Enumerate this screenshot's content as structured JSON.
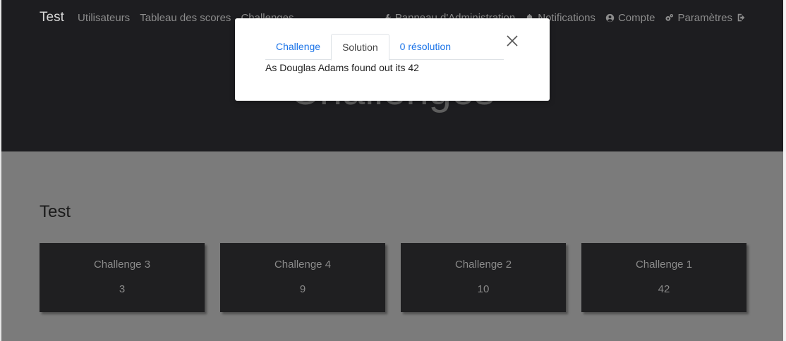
{
  "navbar": {
    "brand": "Test",
    "left_links": [
      "Utilisateurs",
      "Tableau des scores",
      "Challenges"
    ],
    "right_links": [
      {
        "label": "Panneau d'Administration",
        "icon": "wrench-icon"
      },
      {
        "label": "Notifications",
        "icon": "bell-icon"
      },
      {
        "label": "Compte",
        "icon": "user-circle-icon"
      },
      {
        "label": "Paramètres",
        "icon": "gears-icon"
      }
    ],
    "logout_icon": "sign-out-icon"
  },
  "hero": {
    "title": "Challenges"
  },
  "section": {
    "title": "Test",
    "cards": [
      {
        "name": "Challenge 3",
        "value": "3"
      },
      {
        "name": "Challenge 4",
        "value": "9"
      },
      {
        "name": "Challenge 2",
        "value": "10"
      },
      {
        "name": "Challenge 1",
        "value": "42"
      }
    ]
  },
  "modal": {
    "tabs": [
      {
        "label": "Challenge",
        "active": false
      },
      {
        "label": "Solution",
        "active": true
      },
      {
        "label": "0 résolution",
        "active": false
      }
    ],
    "solution_text": "As Douglas Adams found out its 42",
    "close_icon": "close-icon"
  },
  "colors": {
    "accent": "#1a73e8",
    "nav_bg": "#1d1d20",
    "overlay_gray": "#7b7b7b",
    "card_bg": "#1f1f21"
  }
}
